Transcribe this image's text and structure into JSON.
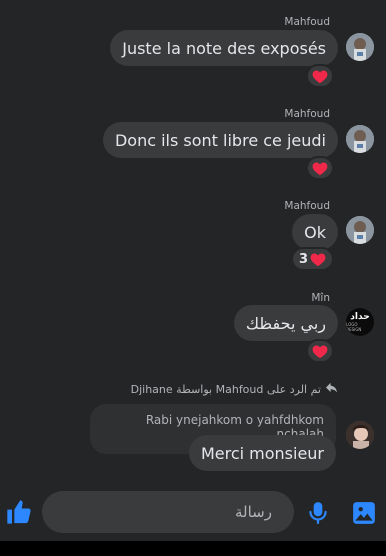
{
  "messages": [
    {
      "sender": "Mahfoud",
      "text": "Juste la note des exposés",
      "reaction": {
        "emoji": "heart",
        "count": ""
      }
    },
    {
      "sender": "Mahfoud",
      "text": "Donc ils sont libre ce jeudi",
      "reaction": {
        "emoji": "heart",
        "count": ""
      }
    },
    {
      "sender": "Mahfoud",
      "text": "Ok",
      "reaction": {
        "emoji": "heart",
        "count": "3"
      }
    },
    {
      "sender": "Mîn",
      "text": "ربي يحفظك",
      "reaction": {
        "emoji": "heart",
        "count": ""
      }
    },
    {
      "sender": "",
      "reply_info": "تم الرد على Mahfoud بواسطة Djihane",
      "quoted_text": "Rabi ynejahkom o yahfdhkom nchalah",
      "text": "Merci monsieur"
    }
  ],
  "avatars": {
    "min_logo_text": "حداد",
    "min_logo_subtext": "LOGO DESIGN"
  },
  "composer": {
    "placeholder": "رسالة",
    "icons": [
      "like-icon",
      "sticker-icon",
      "microphone-icon",
      "image-icon"
    ]
  },
  "colors": {
    "background": "#242526",
    "bubble": "#3a3b3c",
    "accent": "#2d88ff",
    "heart": "#f02849"
  }
}
